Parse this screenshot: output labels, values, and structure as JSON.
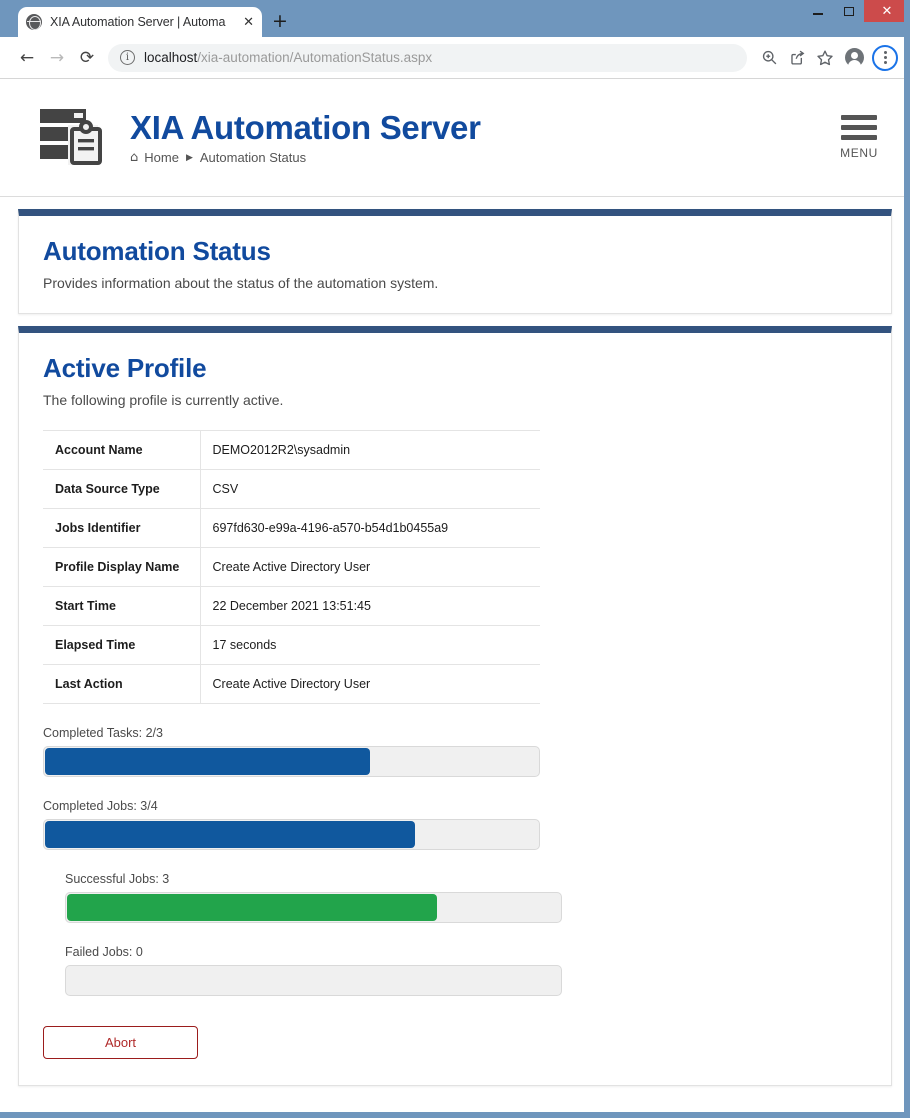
{
  "browser": {
    "tab": {
      "title": "XIA Automation Server | Automa",
      "favicon": "globe-icon",
      "close_label": "✕"
    },
    "new_tab_label": "+",
    "window_controls": {
      "minimize": "minimize-icon",
      "maximize": "maximize-icon",
      "close": "✕"
    },
    "toolbar": {
      "back": "←",
      "forward": "→",
      "reload": "⟳",
      "url_host": "localhost",
      "url_path": "/xia-automation/AutomationStatus.aspx",
      "info_icon": "i",
      "zoom_icon": "zoom-in-icon",
      "share_icon": "share-icon",
      "bookmark_icon": "star-icon",
      "profile_icon": "avatar-icon",
      "menu_icon": "kebab-menu-icon"
    }
  },
  "site_header": {
    "app_title": "XIA Automation Server",
    "breadcrumb": {
      "home_icon": "⌂",
      "home": "Home",
      "separator": "▶",
      "current": "Automation Status"
    },
    "menu_label": "MENU"
  },
  "page": {
    "title": "Automation Status",
    "subtitle": "Provides information about the status of the automation system."
  },
  "active_profile": {
    "title": "Active Profile",
    "subtitle": "The following profile is currently active.",
    "rows": [
      {
        "label": "Account Name",
        "value": "DEMO2012R2\\sysadmin"
      },
      {
        "label": "Data Source Type",
        "value": "CSV"
      },
      {
        "label": "Jobs Identifier",
        "value": "697fd630-e99a-4196-a570-b54d1b0455a9"
      },
      {
        "label": "Profile Display Name",
        "value": "Create Active Directory User"
      },
      {
        "label": "Start Time",
        "value": "22 December 2021 13:51:45"
      },
      {
        "label": "Elapsed Time",
        "value": "17 seconds"
      },
      {
        "label": "Last Action",
        "value": "Create Active Directory User"
      }
    ],
    "progress": [
      {
        "label": "Completed Tasks: 2/3",
        "percent": 66,
        "color": "blue",
        "nested": false
      },
      {
        "label": "Completed Jobs: 3/4",
        "percent": 75,
        "color": "blue",
        "nested": false
      },
      {
        "label": "Successful Jobs: 3",
        "percent": 75,
        "color": "green",
        "nested": true
      },
      {
        "label": "Failed Jobs: 0",
        "percent": 0,
        "color": "green",
        "nested": true
      }
    ],
    "abort_label": "Abort"
  },
  "colors": {
    "brand_blue": "#114a9e",
    "panel_accent": "#33537f",
    "progress_blue": "#10589e",
    "progress_green": "#22a44b",
    "abort_red": "#b02a2a",
    "chrome_frame": "#6f96bd"
  }
}
